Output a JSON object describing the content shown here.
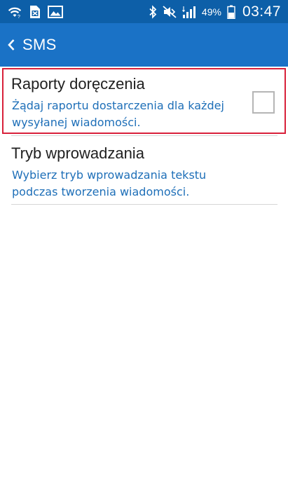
{
  "status_bar": {
    "battery_percent": "49%",
    "time": "03:47",
    "icons": [
      "wifi-icon",
      "sim-blocked-icon",
      "image-icon",
      "bluetooth-icon",
      "mute-icon",
      "signal-icon",
      "battery-icon"
    ]
  },
  "action_bar": {
    "title": "SMS",
    "back_icon": "chevron-left-icon"
  },
  "preferences": [
    {
      "title": "Raporty doręczenia",
      "summary": "Żądaj raportu dostarczenia dla każdej wysyłanej wiadomości.",
      "checked": false
    },
    {
      "title": "Tryb wprowadzania",
      "summary": "Wybierz tryb wprowadzania tekstu podczas tworzenia wiadomości."
    }
  ],
  "colors": {
    "status_bar": "#0d5fa8",
    "action_bar": "#1a72c6",
    "summary_text": "#1e6fb8",
    "highlight_border": "#d8203a"
  }
}
